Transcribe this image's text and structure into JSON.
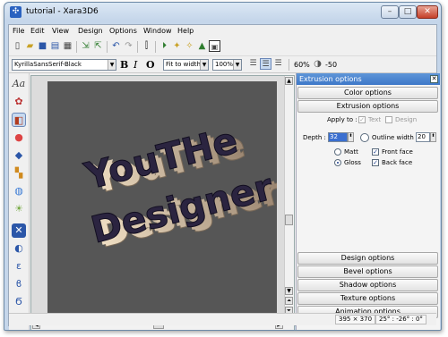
{
  "window": {
    "title": "tutorial - Xara3D6"
  },
  "menu": [
    "File",
    "Edit",
    "View",
    "Design",
    "Options",
    "Window",
    "Help"
  ],
  "toolbar": {
    "font": "KyrillaSansSerif-Black",
    "fit": "Fit to width",
    "zoom": "100%",
    "bold": "B",
    "italic": "I",
    "outline": "O",
    "light": "60%",
    "angle": "-50"
  },
  "left_tools": {
    "text_tool": "Aa"
  },
  "canvas": {
    "line1": "YouTHe",
    "line2": "Designer"
  },
  "panel": {
    "header": "Extrusion options",
    "color_options": "Color options",
    "extrusion_options": "Extrusion options",
    "apply_to_label": "Apply to :",
    "text_label": "Text",
    "design_label": "Design",
    "depth_label": "Depth :",
    "depth_value": "32",
    "outline_width_label": "Outline width :",
    "outline_width_value": "20",
    "matt": "Matt",
    "gloss": "Gloss",
    "front_face": "Front face",
    "back_face": "Back face",
    "design_options": "Design options",
    "bevel_options": "Bevel options",
    "shadow_options": "Shadow options",
    "texture_options": "Texture options",
    "animation_options": "Animation options"
  },
  "status": {
    "size": "395 × 370",
    "angles": "25° : -26° : 0°"
  }
}
